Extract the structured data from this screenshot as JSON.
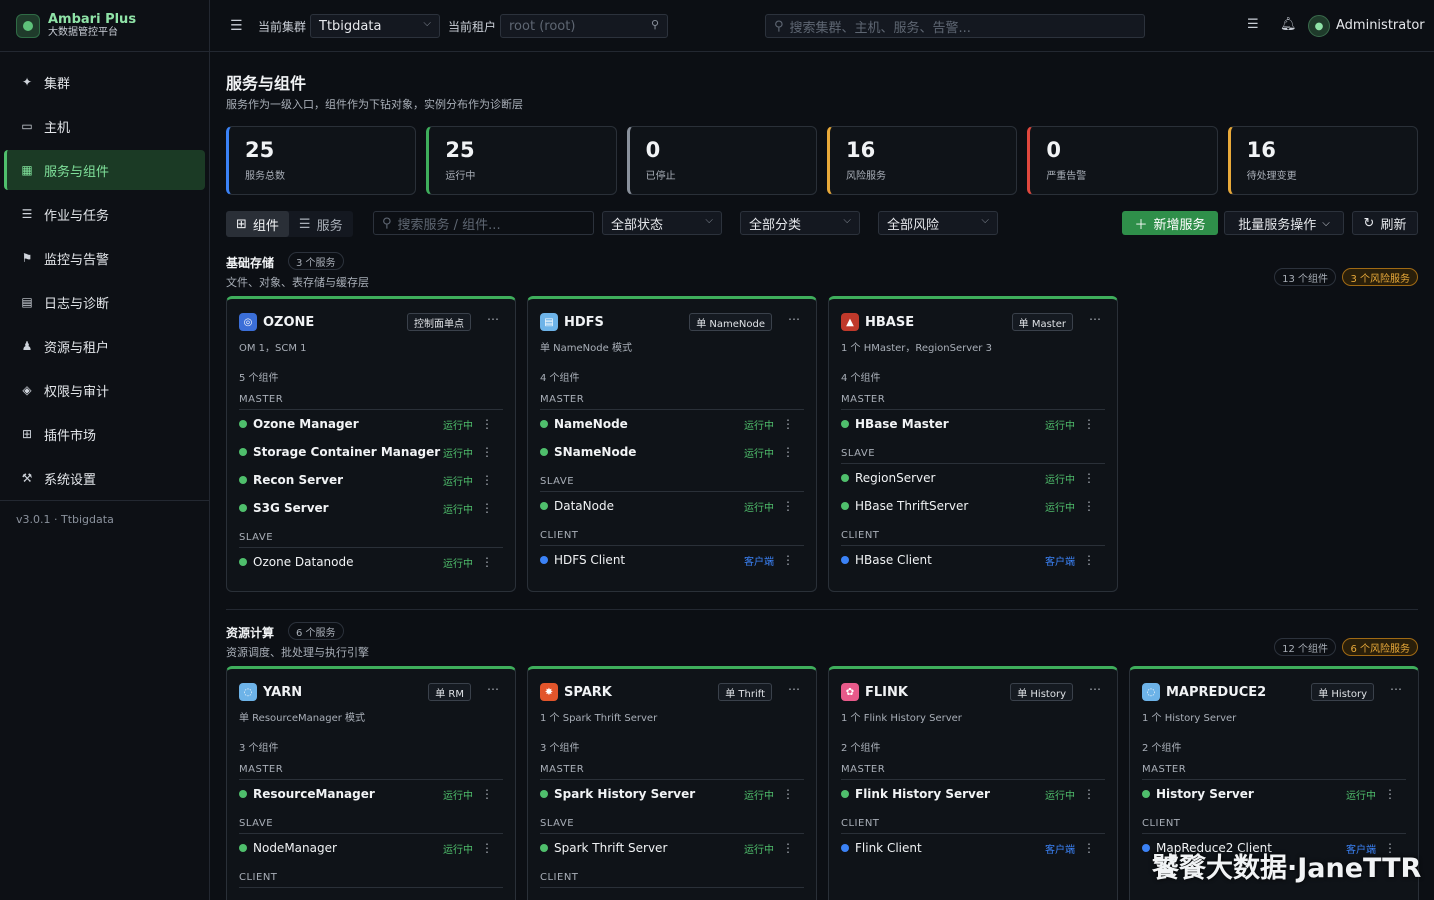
{
  "brand": {
    "title": "Ambari Plus",
    "subtitle": "大数据管控平台"
  },
  "nav": [
    {
      "label": "集群",
      "icon": "rocket-icon",
      "glyph": "✦"
    },
    {
      "label": "主机",
      "icon": "monitor-icon",
      "glyph": "▭"
    },
    {
      "label": "服务与组件",
      "icon": "grid-icon",
      "glyph": "▦",
      "active": true
    },
    {
      "label": "作业与任务",
      "icon": "list-icon",
      "glyph": "☰"
    },
    {
      "label": "监控与告警",
      "icon": "alarm-icon",
      "glyph": "⚑"
    },
    {
      "label": "日志与诊断",
      "icon": "log-icon",
      "glyph": "▤"
    },
    {
      "label": "资源与租户",
      "icon": "users-icon",
      "glyph": "♟"
    },
    {
      "label": "权限与审计",
      "icon": "shield-icon",
      "glyph": "◈"
    },
    {
      "label": "插件市场",
      "icon": "plugin-icon",
      "glyph": "⊞"
    },
    {
      "label": "系统设置",
      "icon": "wrench-icon",
      "glyph": "⚒"
    }
  ],
  "version": "v3.0.1 · Ttbigdata",
  "topbar": {
    "cluster_label": "当前集群",
    "cluster_value": "Ttbigdata",
    "tenant_label": "当前租户",
    "tenant_value": "root (root)",
    "search_placeholder": "搜索集群、主机、服务、告警...",
    "user": "Administrator"
  },
  "page": {
    "title": "服务与组件",
    "subtitle": "服务作为一级入口，组件作为下钻对象，实例分布作为诊断层"
  },
  "stats": [
    {
      "value": "25",
      "label": "服务总数",
      "color": "#3b82f6"
    },
    {
      "value": "25",
      "label": "运行中",
      "color": "#3fae5c"
    },
    {
      "value": "0",
      "label": "已停止",
      "color": "#8a919c"
    },
    {
      "value": "16",
      "label": "风险服务",
      "color": "#e8a93a"
    },
    {
      "value": "0",
      "label": "严重告警",
      "color": "#e0483e"
    },
    {
      "value": "16",
      "label": "待处理变更",
      "color": "#e8a93a"
    }
  ],
  "toolbar": {
    "view_components": "组件",
    "view_services": "服务",
    "search_placeholder": "搜索服务 / 组件...",
    "status": "全部状态",
    "category": "全部分类",
    "risk": "全部风险",
    "add": "新增服务",
    "batch": "批量服务操作",
    "refresh": "刷新"
  },
  "sections": [
    {
      "title": "基础存储",
      "count": "3 个服务",
      "desc": "文件、对象、表存储与缓存层",
      "comp_count": "13 个组件",
      "risk": "3 个风险服务",
      "cards": [
        {
          "name": "OZONE",
          "icon_color": "#3b6fd8",
          "glyph": "◎",
          "badge": "控制面单点",
          "desc": "OM 1，SCM 1",
          "count": "5 个组件",
          "groups": [
            {
              "role": "MASTER",
              "items": [
                {
                  "name": "Ozone Manager",
                  "status": "运行中",
                  "bold": true
                },
                {
                  "name": "Storage Container Manager",
                  "status": "运行中",
                  "bold": true
                },
                {
                  "name": "Recon Server",
                  "status": "运行中",
                  "bold": true
                },
                {
                  "name": "S3G Server",
                  "status": "运行中",
                  "bold": true
                }
              ]
            },
            {
              "role": "SLAVE",
              "items": [
                {
                  "name": "Ozone Datanode",
                  "status": "运行中"
                }
              ]
            }
          ]
        },
        {
          "name": "HDFS",
          "icon_color": "#6db3e8",
          "glyph": "▤",
          "badge": "单 NameNode",
          "desc": "单 NameNode 模式",
          "count": "4 个组件",
          "groups": [
            {
              "role": "MASTER",
              "items": [
                {
                  "name": "NameNode",
                  "status": "运行中",
                  "bold": true
                },
                {
                  "name": "SNameNode",
                  "status": "运行中",
                  "bold": true
                }
              ]
            },
            {
              "role": "SLAVE",
              "items": [
                {
                  "name": "DataNode",
                  "status": "运行中"
                }
              ]
            },
            {
              "role": "CLIENT",
              "items": [
                {
                  "name": "HDFS Client",
                  "status": "客户端",
                  "client": true
                }
              ]
            }
          ]
        },
        {
          "name": "HBASE",
          "icon_color": "#c0392b",
          "glyph": "▲",
          "badge": "单 Master",
          "desc": "1 个 HMaster，RegionServer 3",
          "count": "4 个组件",
          "groups": [
            {
              "role": "MASTER",
              "items": [
                {
                  "name": "HBase Master",
                  "status": "运行中",
                  "bold": true
                }
              ]
            },
            {
              "role": "SLAVE",
              "items": [
                {
                  "name": "RegionServer",
                  "status": "运行中"
                },
                {
                  "name": "HBase ThriftServer",
                  "status": "运行中"
                }
              ]
            },
            {
              "role": "CLIENT",
              "items": [
                {
                  "name": "HBase Client",
                  "status": "客户端",
                  "client": true
                }
              ]
            }
          ]
        }
      ]
    },
    {
      "title": "资源计算",
      "count": "6 个服务",
      "desc": "资源调度、批处理与执行引擎",
      "comp_count": "12 个组件",
      "risk": "6 个风险服务",
      "cards": [
        {
          "name": "YARN",
          "icon_color": "#6db3e8",
          "glyph": "◌",
          "badge": "单 RM",
          "desc": "单 ResourceManager 模式",
          "count": "3 个组件",
          "groups": [
            {
              "role": "MASTER",
              "items": [
                {
                  "name": "ResourceManager",
                  "status": "运行中",
                  "bold": true
                }
              ]
            },
            {
              "role": "SLAVE",
              "items": [
                {
                  "name": "NodeManager",
                  "status": "运行中"
                }
              ]
            },
            {
              "role": "CLIENT",
              "items": []
            }
          ]
        },
        {
          "name": "SPARK",
          "icon_color": "#e2552b",
          "glyph": "✸",
          "badge": "单 Thrift",
          "desc": "1 个 Spark Thrift Server",
          "count": "3 个组件",
          "groups": [
            {
              "role": "MASTER",
              "items": [
                {
                  "name": "Spark History Server",
                  "status": "运行中",
                  "bold": true
                }
              ]
            },
            {
              "role": "SLAVE",
              "items": [
                {
                  "name": "Spark Thrift Server",
                  "status": "运行中"
                }
              ]
            },
            {
              "role": "CLIENT",
              "items": []
            }
          ]
        },
        {
          "name": "FLINK",
          "icon_color": "#e85a8a",
          "glyph": "✿",
          "badge": "单 History",
          "desc": "1 个 Flink History Server",
          "count": "2 个组件",
          "groups": [
            {
              "role": "MASTER",
              "items": [
                {
                  "name": "Flink History Server",
                  "status": "运行中",
                  "bold": true
                }
              ]
            },
            {
              "role": "CLIENT",
              "items": [
                {
                  "name": "Flink Client",
                  "status": "客户端",
                  "client": true
                }
              ]
            }
          ]
        },
        {
          "name": "MAPREDUCE2",
          "icon_color": "#6db3e8",
          "glyph": "◌",
          "badge": "单 History",
          "desc": "1 个 History Server",
          "count": "2 个组件",
          "groups": [
            {
              "role": "MASTER",
              "items": [
                {
                  "name": "History Server",
                  "status": "运行中",
                  "bold": true
                }
              ]
            },
            {
              "role": "CLIENT",
              "items": [
                {
                  "name": "MapReduce2 Client",
                  "status": "客户端",
                  "client": true
                }
              ]
            }
          ]
        }
      ]
    }
  ],
  "watermark": "饕餮大数据·JaneTTR"
}
